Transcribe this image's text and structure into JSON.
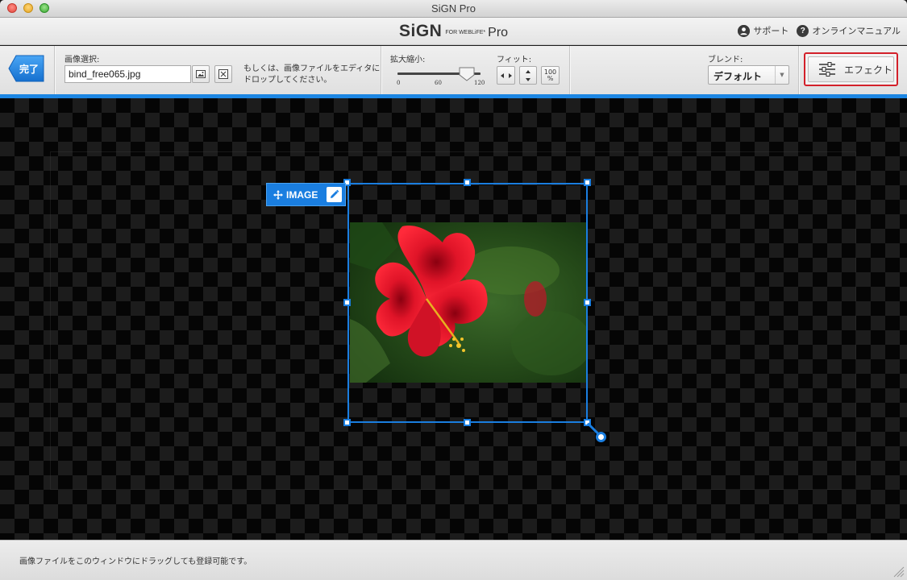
{
  "window": {
    "title": "SiGN Pro"
  },
  "header": {
    "logo_main": "SiGN",
    "logo_small": "FOR WEBLiFE*",
    "logo_pro": "Pro",
    "links": [
      {
        "label": "サポート",
        "icon": "person-icon"
      },
      {
        "label": "オンラインマニュアル",
        "icon": "question-icon"
      }
    ]
  },
  "toolbar": {
    "done_label": "完了",
    "image_select_label": "画像選択:",
    "file_value": "bind_free065.jpg",
    "drop_note_line1": "もしくは、画像ファイルをエディタに",
    "drop_note_line2": "ドロップしてください。",
    "zoom_label": "拡大縮小:",
    "zoom_ticks": [
      "0",
      "60",
      "120"
    ],
    "zoom_value": 100,
    "zoom_min": 0,
    "zoom_max": 120,
    "fit_label": "フィット:",
    "fit_100_label": "100",
    "fit_percent": "%",
    "blend_label": "ブレンド:",
    "blend_value": "デフォルト",
    "effect_label": "エフェクト"
  },
  "canvas": {
    "layer_tag": "IMAGE"
  },
  "status": {
    "text": "画像ファイルをこのウィンドウにドラッグしても登録可能です。"
  },
  "colors": {
    "accent": "#1a7ee0",
    "effect_border": "#d3202a"
  }
}
